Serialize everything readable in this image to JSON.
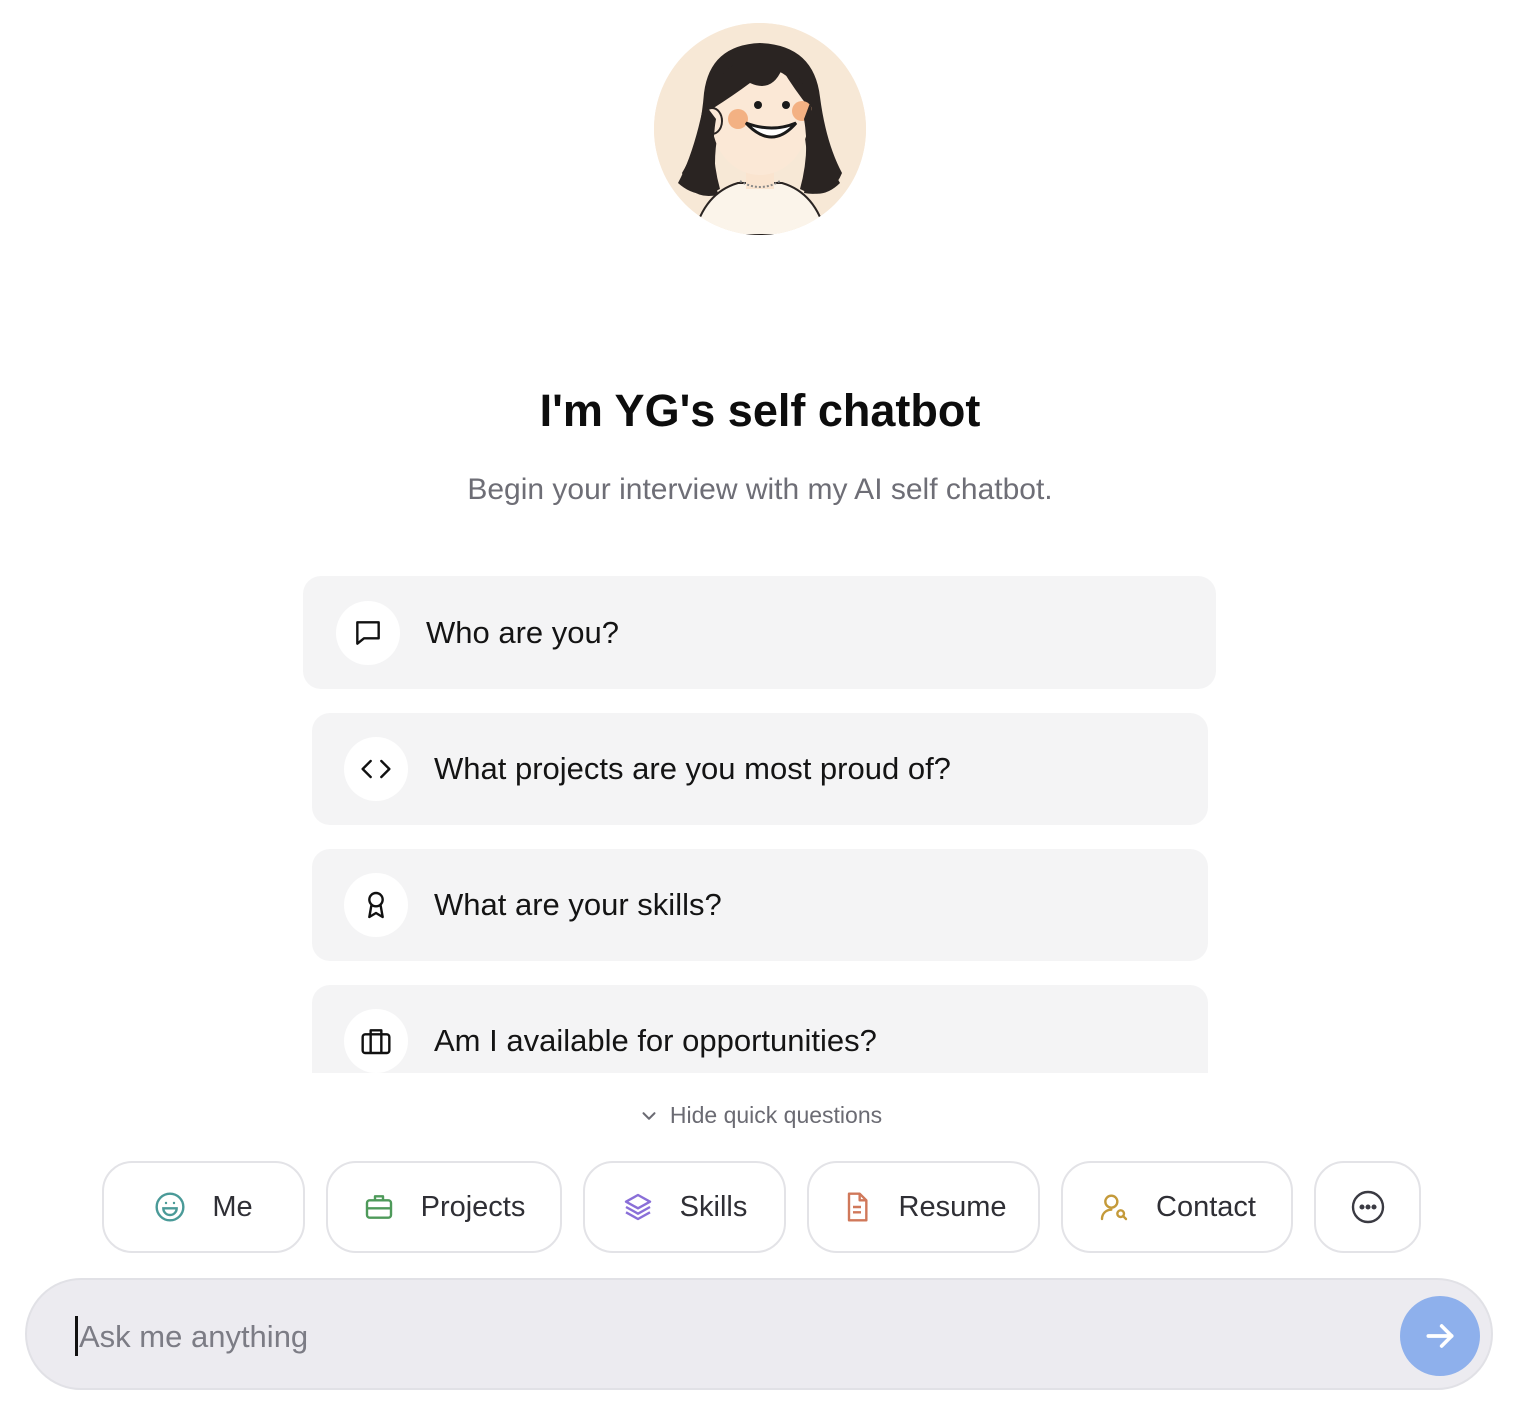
{
  "header": {
    "title": "I'm YG's self chatbot",
    "subtitle": "Begin your interview with my AI self chatbot."
  },
  "quick_questions": [
    {
      "icon": "message-square-icon",
      "label": "Who are you?"
    },
    {
      "icon": "code-icon",
      "label": "What projects are you most proud of?"
    },
    {
      "icon": "award-icon",
      "label": "What are your skills?"
    },
    {
      "icon": "briefcase-icon",
      "label": "Am I available for opportunities?"
    }
  ],
  "toggle": {
    "label": "Hide quick questions",
    "icon": "chevron-down-icon"
  },
  "categories": [
    {
      "icon": "smile-icon",
      "label": "Me",
      "color": "#4a9a98"
    },
    {
      "icon": "briefcase-icon",
      "label": "Projects",
      "color": "#4e9a5a"
    },
    {
      "icon": "layers-icon",
      "label": "Skills",
      "color": "#8a6fd8"
    },
    {
      "icon": "file-text-icon",
      "label": "Resume",
      "color": "#d0785a"
    },
    {
      "icon": "user-search-icon",
      "label": "Contact",
      "color": "#c49a3a"
    },
    {
      "icon": "more-horizontal-icon",
      "label": "",
      "color": "#3a3a42"
    }
  ],
  "input": {
    "placeholder": "Ask me anything",
    "value": ""
  },
  "colors": {
    "send_button": "#8eb0ec",
    "card_background": "#f4f4f5"
  }
}
